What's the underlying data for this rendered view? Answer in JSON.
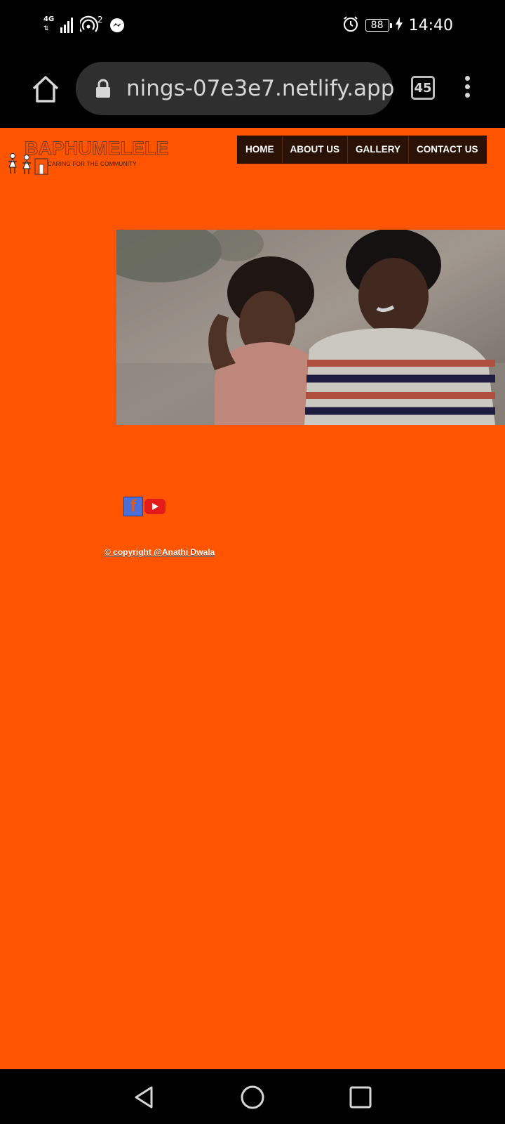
{
  "status_bar": {
    "network_type": "4G",
    "hotspot_count": "2",
    "battery": "88",
    "time": "14:40",
    "icons": [
      "signal-icon",
      "hotspot-icon",
      "messenger-icon",
      "alarm-icon",
      "battery-icon",
      "charging-icon"
    ]
  },
  "browser": {
    "url": "nings-07e3e7.netlify.app",
    "tab_count": "45",
    "icons": [
      "home-icon",
      "lock-icon",
      "menu-dots-icon"
    ]
  },
  "site": {
    "logo_text": "BAPHUMELELE",
    "tagline": "CARING FOR THE COMMUNITY",
    "nav": [
      "HOME",
      "ABOUT US",
      "GALLERY",
      "CONTACT US"
    ],
    "copyright": "© copyright @Anathi Dwala",
    "social": [
      "facebook-icon",
      "youtube-icon"
    ],
    "colors": {
      "background": "#ff5500",
      "nav_bg": "#2b1206",
      "nav_text": "#ffffff"
    }
  },
  "system_nav": {
    "icons": [
      "back-icon",
      "home-circle-icon",
      "recents-icon"
    ]
  }
}
